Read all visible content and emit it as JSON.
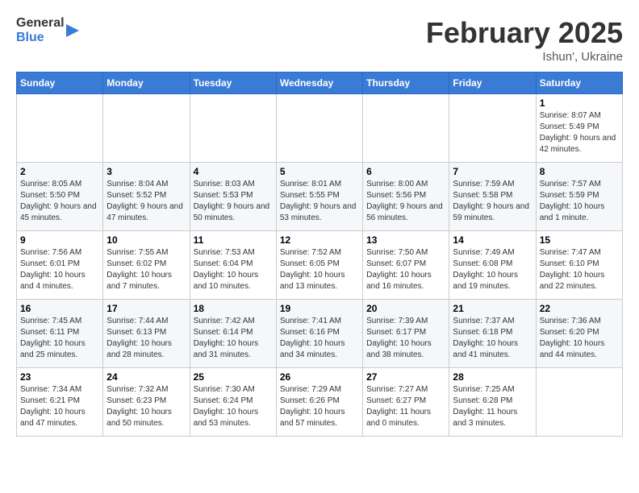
{
  "header": {
    "logo_general": "General",
    "logo_blue": "Blue",
    "month_title": "February 2025",
    "location": "Ishun', Ukraine"
  },
  "weekdays": [
    "Sunday",
    "Monday",
    "Tuesday",
    "Wednesday",
    "Thursday",
    "Friday",
    "Saturday"
  ],
  "weeks": [
    [
      {
        "day": "",
        "info": ""
      },
      {
        "day": "",
        "info": ""
      },
      {
        "day": "",
        "info": ""
      },
      {
        "day": "",
        "info": ""
      },
      {
        "day": "",
        "info": ""
      },
      {
        "day": "",
        "info": ""
      },
      {
        "day": "1",
        "info": "Sunrise: 8:07 AM\nSunset: 5:49 PM\nDaylight: 9 hours and 42 minutes."
      }
    ],
    [
      {
        "day": "2",
        "info": "Sunrise: 8:05 AM\nSunset: 5:50 PM\nDaylight: 9 hours and 45 minutes."
      },
      {
        "day": "3",
        "info": "Sunrise: 8:04 AM\nSunset: 5:52 PM\nDaylight: 9 hours and 47 minutes."
      },
      {
        "day": "4",
        "info": "Sunrise: 8:03 AM\nSunset: 5:53 PM\nDaylight: 9 hours and 50 minutes."
      },
      {
        "day": "5",
        "info": "Sunrise: 8:01 AM\nSunset: 5:55 PM\nDaylight: 9 hours and 53 minutes."
      },
      {
        "day": "6",
        "info": "Sunrise: 8:00 AM\nSunset: 5:56 PM\nDaylight: 9 hours and 56 minutes."
      },
      {
        "day": "7",
        "info": "Sunrise: 7:59 AM\nSunset: 5:58 PM\nDaylight: 9 hours and 59 minutes."
      },
      {
        "day": "8",
        "info": "Sunrise: 7:57 AM\nSunset: 5:59 PM\nDaylight: 10 hours and 1 minute."
      }
    ],
    [
      {
        "day": "9",
        "info": "Sunrise: 7:56 AM\nSunset: 6:01 PM\nDaylight: 10 hours and 4 minutes."
      },
      {
        "day": "10",
        "info": "Sunrise: 7:55 AM\nSunset: 6:02 PM\nDaylight: 10 hours and 7 minutes."
      },
      {
        "day": "11",
        "info": "Sunrise: 7:53 AM\nSunset: 6:04 PM\nDaylight: 10 hours and 10 minutes."
      },
      {
        "day": "12",
        "info": "Sunrise: 7:52 AM\nSunset: 6:05 PM\nDaylight: 10 hours and 13 minutes."
      },
      {
        "day": "13",
        "info": "Sunrise: 7:50 AM\nSunset: 6:07 PM\nDaylight: 10 hours and 16 minutes."
      },
      {
        "day": "14",
        "info": "Sunrise: 7:49 AM\nSunset: 6:08 PM\nDaylight: 10 hours and 19 minutes."
      },
      {
        "day": "15",
        "info": "Sunrise: 7:47 AM\nSunset: 6:10 PM\nDaylight: 10 hours and 22 minutes."
      }
    ],
    [
      {
        "day": "16",
        "info": "Sunrise: 7:45 AM\nSunset: 6:11 PM\nDaylight: 10 hours and 25 minutes."
      },
      {
        "day": "17",
        "info": "Sunrise: 7:44 AM\nSunset: 6:13 PM\nDaylight: 10 hours and 28 minutes."
      },
      {
        "day": "18",
        "info": "Sunrise: 7:42 AM\nSunset: 6:14 PM\nDaylight: 10 hours and 31 minutes."
      },
      {
        "day": "19",
        "info": "Sunrise: 7:41 AM\nSunset: 6:16 PM\nDaylight: 10 hours and 34 minutes."
      },
      {
        "day": "20",
        "info": "Sunrise: 7:39 AM\nSunset: 6:17 PM\nDaylight: 10 hours and 38 minutes."
      },
      {
        "day": "21",
        "info": "Sunrise: 7:37 AM\nSunset: 6:18 PM\nDaylight: 10 hours and 41 minutes."
      },
      {
        "day": "22",
        "info": "Sunrise: 7:36 AM\nSunset: 6:20 PM\nDaylight: 10 hours and 44 minutes."
      }
    ],
    [
      {
        "day": "23",
        "info": "Sunrise: 7:34 AM\nSunset: 6:21 PM\nDaylight: 10 hours and 47 minutes."
      },
      {
        "day": "24",
        "info": "Sunrise: 7:32 AM\nSunset: 6:23 PM\nDaylight: 10 hours and 50 minutes."
      },
      {
        "day": "25",
        "info": "Sunrise: 7:30 AM\nSunset: 6:24 PM\nDaylight: 10 hours and 53 minutes."
      },
      {
        "day": "26",
        "info": "Sunrise: 7:29 AM\nSunset: 6:26 PM\nDaylight: 10 hours and 57 minutes."
      },
      {
        "day": "27",
        "info": "Sunrise: 7:27 AM\nSunset: 6:27 PM\nDaylight: 11 hours and 0 minutes."
      },
      {
        "day": "28",
        "info": "Sunrise: 7:25 AM\nSunset: 6:28 PM\nDaylight: 11 hours and 3 minutes."
      },
      {
        "day": "",
        "info": ""
      }
    ]
  ]
}
